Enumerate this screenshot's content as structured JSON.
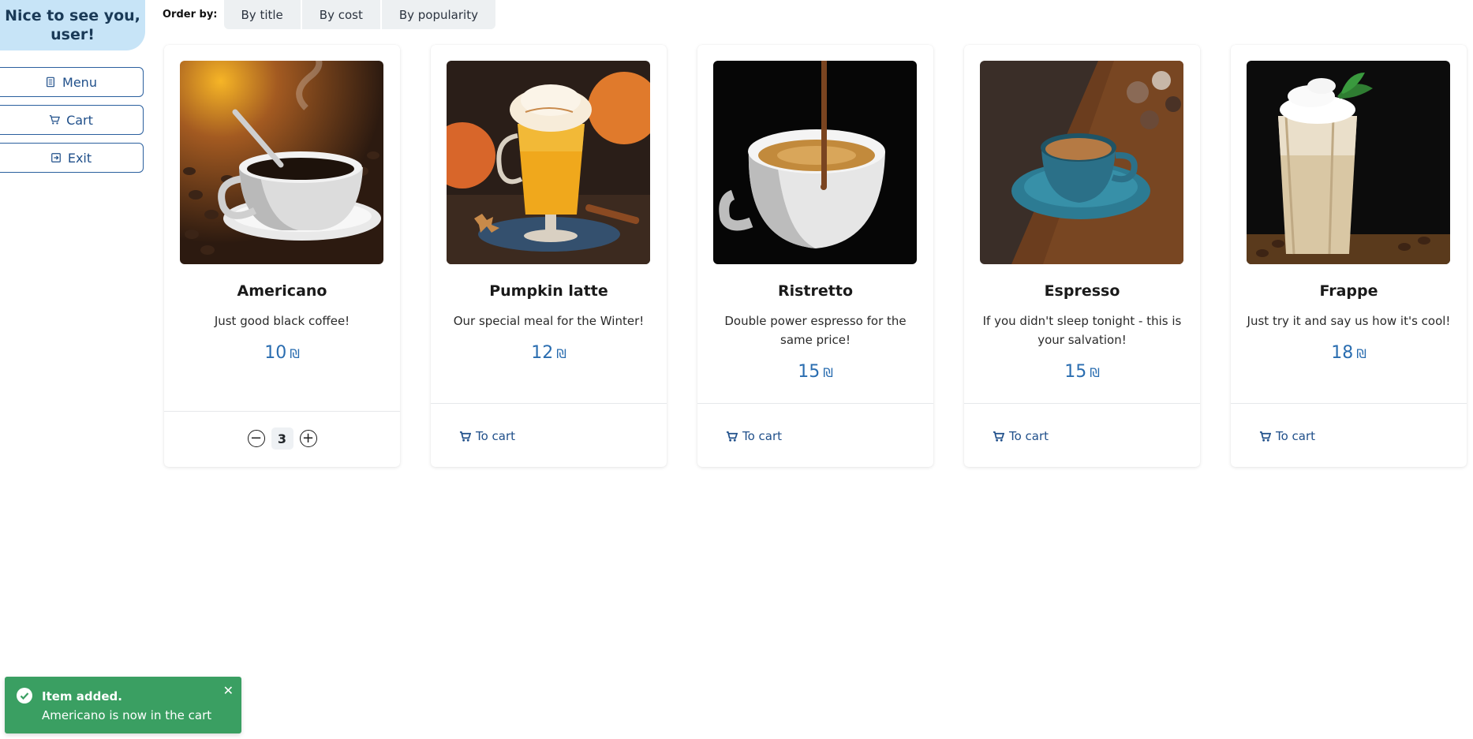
{
  "sidebar": {
    "greeting": "Nice to see you, user!",
    "menu_label": "Menu",
    "cart_label": "Cart",
    "exit_label": "Exit"
  },
  "order_bar": {
    "label": "Order by:",
    "options": [
      "By title",
      "By cost",
      "By popularity"
    ]
  },
  "products": [
    {
      "title": "Americano",
      "description": "Just good black coffee!",
      "price": "10",
      "currency": "₪",
      "in_cart": true,
      "quantity": "3"
    },
    {
      "title": "Pumpkin latte",
      "description": "Our special meal for the Winter!",
      "price": "12",
      "currency": "₪",
      "in_cart": false,
      "action_label": "To cart"
    },
    {
      "title": "Ristretto",
      "description": "Double power espresso for the same price!",
      "price": "15",
      "currency": "₪",
      "in_cart": false,
      "action_label": "To cart"
    },
    {
      "title": "Espresso",
      "description": "If you didn't sleep tonight - this is your salvation!",
      "price": "15",
      "currency": "₪",
      "in_cart": false,
      "action_label": "To cart"
    },
    {
      "title": "Frappe",
      "description": "Just try it and say us how it's cool!",
      "price": "18",
      "currency": "₪",
      "in_cart": false,
      "action_label": "To cart"
    }
  ],
  "toast": {
    "title": "Item added.",
    "message": "Americano is now in the cart",
    "close_glyph": "✕"
  },
  "colors": {
    "accent": "#2a6db0",
    "greeting_bg": "#c7e4f7",
    "toast_bg": "#3a9f62"
  }
}
